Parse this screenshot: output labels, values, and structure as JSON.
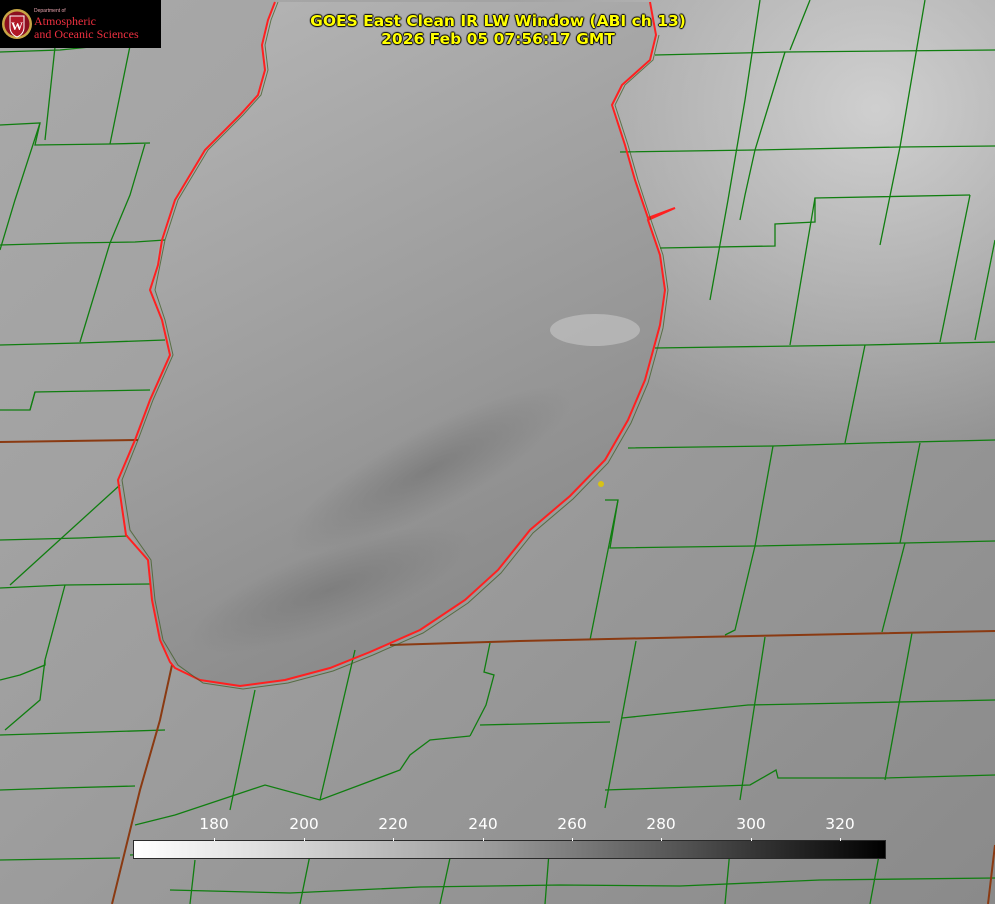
{
  "logo": {
    "department": "Department of",
    "name_line1": "Atmospheric",
    "name_line2": "and Oceanic Sciences",
    "seal_letter": "W"
  },
  "title": {
    "line1": "GOES East Clean IR LW Window (ABI ch 13)",
    "line2": "2026 Feb 05 07:56:17 GMT"
  },
  "colorbar": {
    "colormap": "white-to-black (cold bright, warm dark)",
    "min": 162,
    "max": 330,
    "ticks": [
      "180",
      "200",
      "220",
      "240",
      "260",
      "280",
      "300",
      "320"
    ]
  },
  "colors": {
    "title_text": "#ffff00",
    "coastline": "#ff2020",
    "boundaries": "#107e10",
    "major_boundaries": "#8a3a12",
    "marker": "#d7c216",
    "logo_red": "#ee3040"
  }
}
